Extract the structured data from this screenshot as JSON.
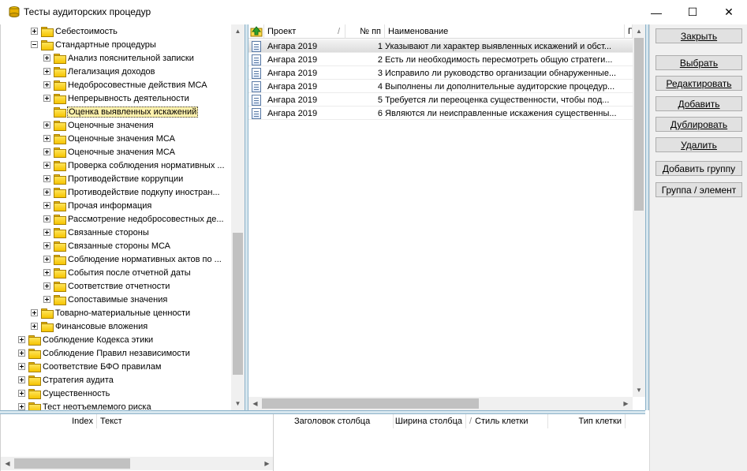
{
  "window": {
    "title": "Тесты аудиторских процедур",
    "minimize": "—",
    "maximize": "☐",
    "close": "✕"
  },
  "tree": {
    "items": [
      {
        "label": "Себестоимость",
        "level": 2,
        "expander": "plus"
      },
      {
        "label": "Стандартные процедуры",
        "level": 2,
        "expander": "minus"
      },
      {
        "label": "Анализ пояснительной записки",
        "level": 3,
        "expander": "plus"
      },
      {
        "label": "Легализация доходов",
        "level": 3,
        "expander": "plus"
      },
      {
        "label": "Недобросовестные действия МСА",
        "level": 3,
        "expander": "plus"
      },
      {
        "label": "Непрерывность деятельности",
        "level": 3,
        "expander": "plus"
      },
      {
        "label": "Оценка выявленных искажений",
        "level": 3,
        "expander": "none",
        "selected": true
      },
      {
        "label": "Оценочные значения",
        "level": 3,
        "expander": "plus"
      },
      {
        "label": "Оценочные значения МСА",
        "level": 3,
        "expander": "plus"
      },
      {
        "label": "Оценочные значения МСА",
        "level": 3,
        "expander": "plus"
      },
      {
        "label": "Проверка соблюдения нормативных ...",
        "level": 3,
        "expander": "plus"
      },
      {
        "label": "Противодействие коррупции",
        "level": 3,
        "expander": "plus"
      },
      {
        "label": "Противодействие подкупу иностран...",
        "level": 3,
        "expander": "plus"
      },
      {
        "label": "Прочая информация",
        "level": 3,
        "expander": "plus"
      },
      {
        "label": "Рассмотрение недобросовестных де...",
        "level": 3,
        "expander": "plus"
      },
      {
        "label": "Связанные стороны",
        "level": 3,
        "expander": "plus"
      },
      {
        "label": "Связанные стороны МСА",
        "level": 3,
        "expander": "plus"
      },
      {
        "label": "Соблюдение нормативных актов по ...",
        "level": 3,
        "expander": "plus"
      },
      {
        "label": "События после отчетной даты",
        "level": 3,
        "expander": "plus"
      },
      {
        "label": "Соответствие отчетности",
        "level": 3,
        "expander": "plus"
      },
      {
        "label": "Сопоставимые значения",
        "level": 3,
        "expander": "plus"
      },
      {
        "label": "Товарно-материальные ценности",
        "level": 2,
        "expander": "plus"
      },
      {
        "label": "Финансовые вложения",
        "level": 2,
        "expander": "plus"
      },
      {
        "label": "Соблюдение Кодекса этики",
        "level": 1,
        "expander": "plus"
      },
      {
        "label": "Соблюдение Правил независимости",
        "level": 1,
        "expander": "plus"
      },
      {
        "label": "Соответствие БФО правилам",
        "level": 1,
        "expander": "plus"
      },
      {
        "label": "Стратегия аудита",
        "level": 1,
        "expander": "plus"
      },
      {
        "label": "Существенность",
        "level": 1,
        "expander": "plus"
      },
      {
        "label": "Тест неотъемлемого риска",
        "level": 1,
        "expander": "plus"
      }
    ]
  },
  "grid": {
    "columns": {
      "project": "Проект",
      "sort_mark": "/",
      "num": "№ пп",
      "name": "Наименование",
      "extra": "П"
    },
    "rows": [
      {
        "project": "Ангара 2019",
        "num": "1",
        "name": "Указывают ли характер выявленных искажений и обст..."
      },
      {
        "project": "Ангара 2019",
        "num": "2",
        "name": "Есть ли необходимость пересмотреть общую стратеги..."
      },
      {
        "project": "Ангара 2019",
        "num": "3",
        "name": "Исправило ли руководство организации обнаруженные..."
      },
      {
        "project": "Ангара 2019",
        "num": "4",
        "name": "Выполнены ли дополнительные аудиторские процедур..."
      },
      {
        "project": "Ангара 2019",
        "num": "5",
        "name": "Требуется ли  переоценка существенности, чтобы под..."
      },
      {
        "project": "Ангара 2019",
        "num": "6",
        "name": "Являются ли неисправленные искажения существенны..."
      }
    ]
  },
  "actions": {
    "close": "Закрыть",
    "select": "Выбрать",
    "edit": "Редактировать",
    "add": "Добавить",
    "duplicate": "Дублировать",
    "delete": "Удалить",
    "add_group": "Добавить группу",
    "group_element": "Группа / элемент"
  },
  "bottom_left": {
    "col_index": "Index",
    "col_text": "Текст"
  },
  "bottom_right": {
    "col_header": "Заголовок столбца",
    "col_width": "Ширина столбца",
    "sort_mark": "/",
    "col_style": "Стиль клетки",
    "col_type": "Тип клетки"
  }
}
